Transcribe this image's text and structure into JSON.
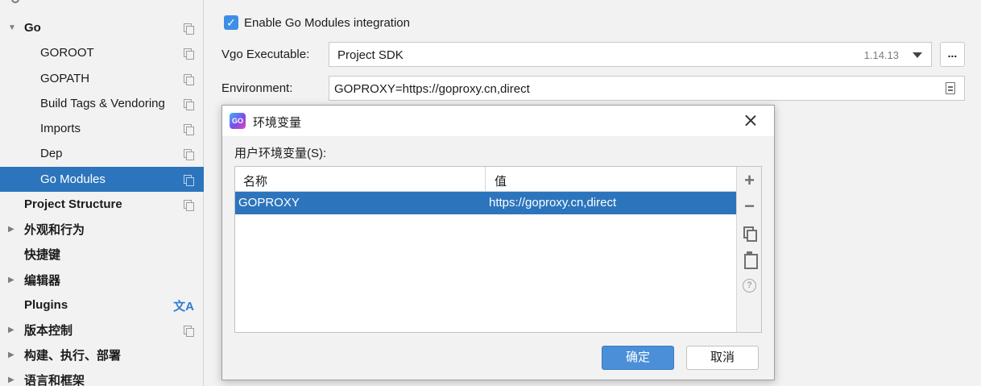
{
  "sidebar": {
    "items": [
      {
        "label": "Go"
      },
      {
        "label": "GOROOT"
      },
      {
        "label": "GOPATH"
      },
      {
        "label": "Build Tags & Vendoring"
      },
      {
        "label": "Imports"
      },
      {
        "label": "Dep"
      },
      {
        "label": "Go Modules"
      },
      {
        "label": "Project Structure"
      },
      {
        "label": "外观和行为"
      },
      {
        "label": "快捷键"
      },
      {
        "label": "编辑器"
      },
      {
        "label": "Plugins"
      },
      {
        "label": "版本控制"
      },
      {
        "label": "构建、执行、部署"
      },
      {
        "label": "语言和框架"
      }
    ],
    "selected": "Go Modules",
    "plugins_icon": "文A"
  },
  "main": {
    "enable_label": "Enable Go Modules integration",
    "vgo_label": "Vgo Executable:",
    "vgo_value": "Project SDK",
    "vgo_version": "1.14.13",
    "ellipsis": "...",
    "env_label": "Environment:",
    "env_value": "GOPROXY=https://goproxy.cn,direct"
  },
  "dialog": {
    "icon_text": "GO",
    "title": "环境变量",
    "user_env_label": "用户环境变量(S):",
    "columns": [
      "名称",
      "值"
    ],
    "rows": [
      {
        "name": "GOPROXY",
        "value": "https://goproxy.cn,direct"
      }
    ],
    "toolbar": {
      "add": "+",
      "remove": "−",
      "help": "?"
    },
    "ok_label": "确定",
    "cancel_label": "取消"
  },
  "colors": {
    "selection": "#2c75bd",
    "checkbox": "#3d8ee6",
    "ok_button": "#4a8fd8"
  }
}
